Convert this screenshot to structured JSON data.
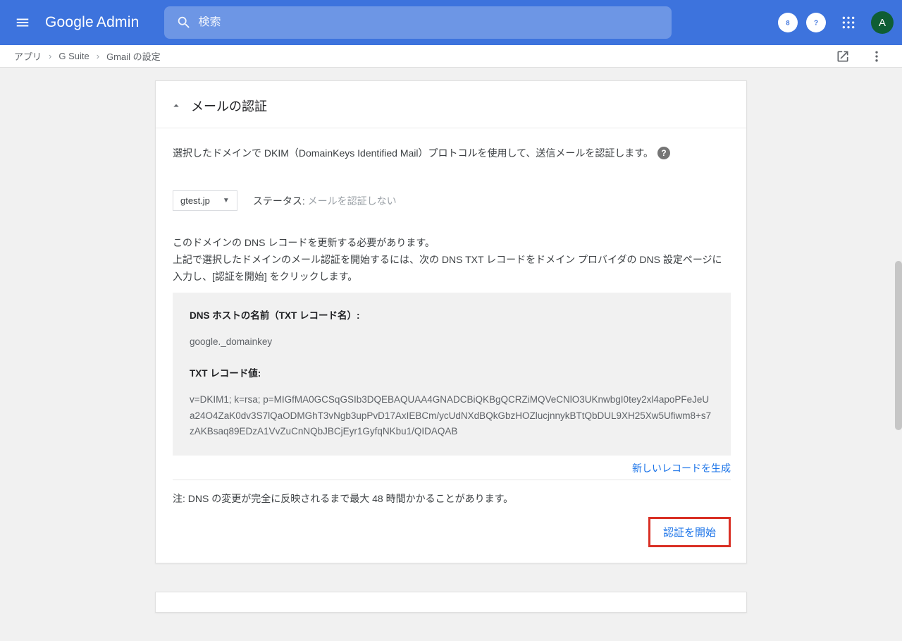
{
  "header": {
    "logo_product": "Google",
    "logo_admin": "Admin",
    "search_placeholder": "検索",
    "avatar_letter": "A"
  },
  "breadcrumb": {
    "items": [
      "アプリ",
      "G Suite",
      "Gmail の設定"
    ]
  },
  "card": {
    "title": "メールの認証",
    "intro": "選択したドメインで DKIM（DomainKeys Identified Mail）プロトコルを使用して、送信メールを認証します。",
    "domain_value": "gtest.jp",
    "status_label": "ステータス:",
    "status_value": "メールを認証しない",
    "instr_line1": "このドメインの DNS レコードを更新する必要があります。",
    "instr_line2": "上記で選択したドメインのメール認証を開始するには、次の DNS TXT レコードをドメイン プロバイダの DNS 設定ページに入力し、[認証を開始] をクリックします。",
    "dns_host_label": "DNS ホストの名前（TXT レコード名）:",
    "dns_host_value": "google._domainkey",
    "dns_txt_label": "TXT レコード値:",
    "dns_txt_value": "v=DKIM1; k=rsa; p=MIGfMA0GCSqGSIb3DQEBAQUAA4GNADCBiQKBgQCRZiMQVeCNlO3UKnwbgI0tey2xl4apoPFeJeUa24O4ZaK0dv3S7lQaODMGhT3vNgb3upPvD17AxIEBCm/ycUdNXdBQkGbzHOZlucjnnykBTtQbDUL9XH25Xw5Ufiwm8+s7zAKBsaq89EDzA1VvZuCnNQbJBCjEyr1GyfqNKbu1/QIDAQAB",
    "generate_link": "新しいレコードを生成",
    "note": "注: DNS の変更が完全に反映されるまで最大 48 時間かかることがあります。",
    "start_button": "認証を開始"
  }
}
